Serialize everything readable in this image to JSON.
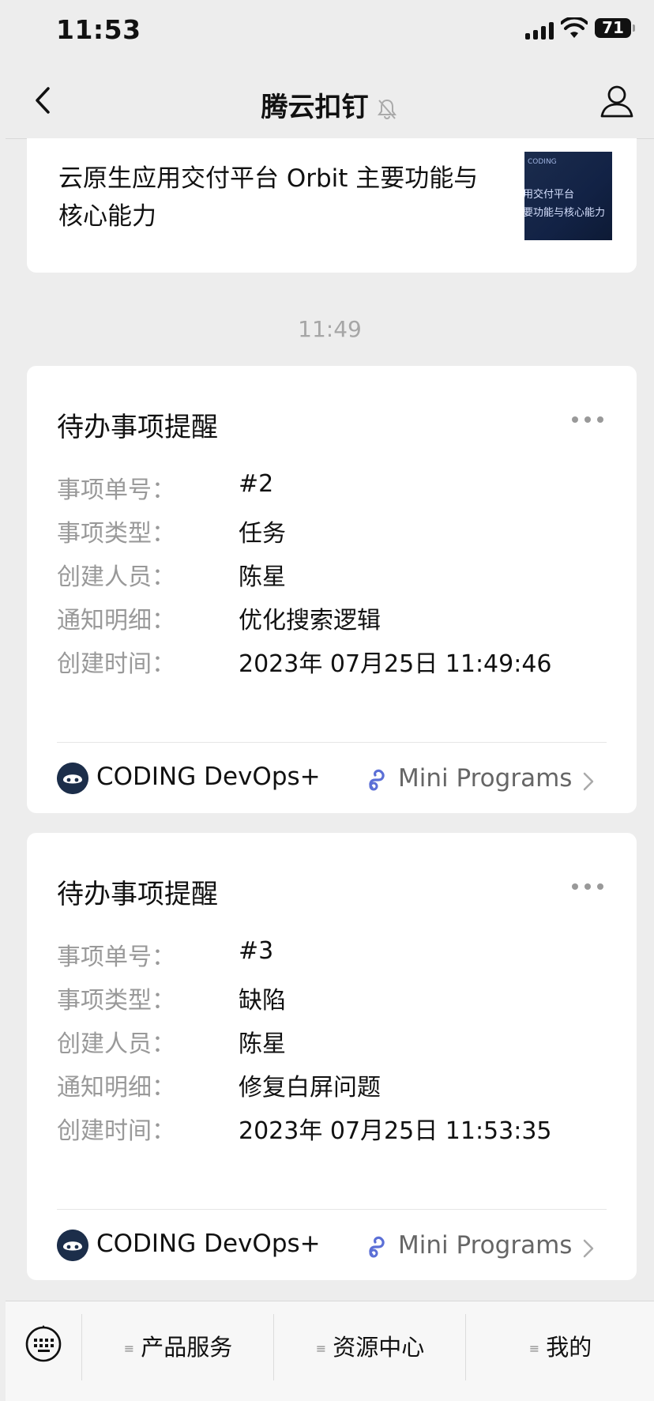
{
  "status_bar": {
    "time": "11:53",
    "battery": "71"
  },
  "nav": {
    "title": "腾云扣钉"
  },
  "article": {
    "title": "云原生应用交付平台 Orbit 主要功能与核心能力",
    "thumb_line1": "CODING",
    "thumb_line2": "用交付平台",
    "thumb_line3": "要功能与核心能力"
  },
  "time_separator": "11:49",
  "cards": [
    {
      "title": "待办事项提醒",
      "rows": [
        {
          "label": "事项单号：",
          "value": "#2"
        },
        {
          "label": "事项类型：",
          "value": "任务"
        },
        {
          "label": "创建人员：",
          "value": "陈星"
        },
        {
          "label": "通知明细：",
          "value": "优化搜索逻辑"
        },
        {
          "label": "创建时间：",
          "value": "2023年 07月25日 11:49:46"
        }
      ],
      "app_name": "CODING DevOps+",
      "mini_programs": "Mini Programs"
    },
    {
      "title": "待办事项提醒",
      "rows": [
        {
          "label": "事项单号：",
          "value": "#3"
        },
        {
          "label": "事项类型：",
          "value": "缺陷"
        },
        {
          "label": "创建人员：",
          "value": "陈星"
        },
        {
          "label": "通知明细：",
          "value": "修复白屏问题"
        },
        {
          "label": "创建时间：",
          "value": "2023年 07月25日 11:53:35"
        }
      ],
      "app_name": "CODING DevOps+",
      "mini_programs": "Mini Programs"
    }
  ],
  "bottom_menu": [
    {
      "label": "产品服务"
    },
    {
      "label": "资源中心"
    },
    {
      "label": "我的"
    }
  ],
  "colors": {
    "mini_program_accent": "#5b6fd6",
    "label_gray": "#999999",
    "logo_navy": "#1c2e4a"
  }
}
